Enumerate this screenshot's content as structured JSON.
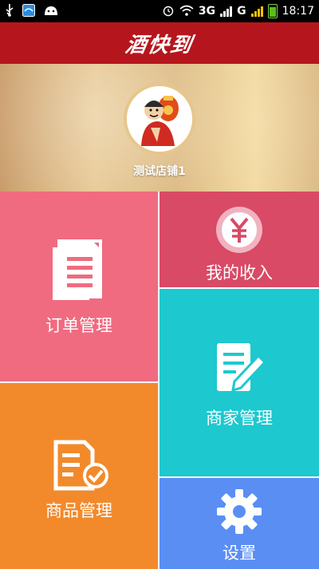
{
  "statusbar": {
    "network_3g": "3G",
    "network_g": "G",
    "time": "18:17"
  },
  "header": {
    "logo_text": "酒快到"
  },
  "shop": {
    "name": "测试店铺1"
  },
  "tiles": {
    "orders": {
      "label": "订单管理",
      "color": "#f06b80",
      "icon": "document-icon"
    },
    "income": {
      "label": "我的收入",
      "color": "#d84a66",
      "icon": "yuan-coin-icon"
    },
    "merchant": {
      "label": "商家管理",
      "color": "#1ec8cf",
      "icon": "edit-note-icon"
    },
    "goods": {
      "label": "商品管理",
      "color": "#f28a2b",
      "icon": "checklist-icon"
    },
    "settings": {
      "label": "设置",
      "color": "#5a8ef3",
      "icon": "gear-icon"
    }
  }
}
